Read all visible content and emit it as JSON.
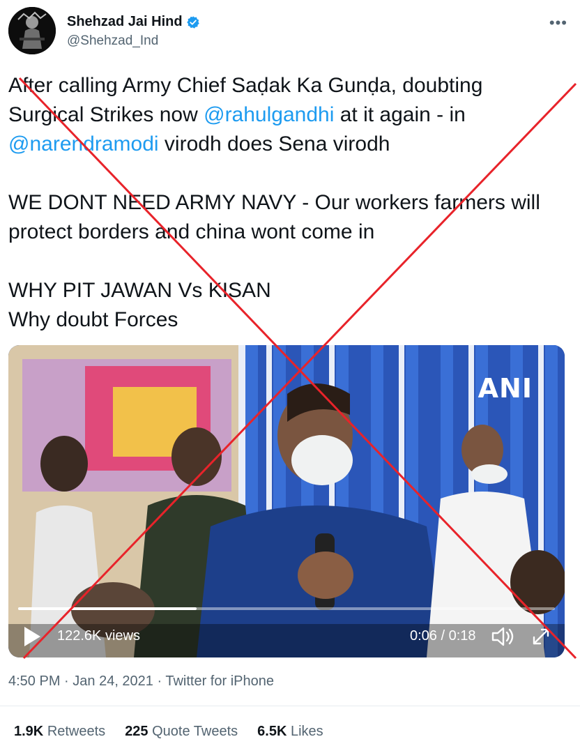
{
  "author": {
    "display_name": "Shehzad Jai Hind",
    "handle": "@Shehzad_Ind",
    "verified": true
  },
  "tweet": {
    "lines": [
      [
        {
          "t": "After calling Army Chief Saḍak Ka Gunḍa, doubting",
          "m": false
        }
      ],
      [
        {
          "t": "Surgical Strikes now ",
          "m": false
        },
        {
          "t": "@rahulgandhi",
          "m": true
        },
        {
          "t": " at it again - in",
          "m": false
        }
      ],
      [
        {
          "t": "@narendramodi",
          "m": true
        },
        {
          "t": " virodh does Sena virodh",
          "m": false
        }
      ],
      [],
      [
        {
          "t": "WE DONT NEED ARMY NAVY - Our workers farmers will",
          "m": false
        }
      ],
      [
        {
          "t": "protect borders and china wont come in",
          "m": false
        }
      ],
      [],
      [
        {
          "t": "WHY PIT JAWAN Vs KISAN",
          "m": false
        }
      ],
      [
        {
          "t": "Why doubt Forces",
          "m": false
        }
      ]
    ]
  },
  "video": {
    "watermark": "ANI",
    "views": "122.6K views",
    "time": "0:06 / 0:18",
    "progress": 0.333
  },
  "meta": {
    "time": "4:50 PM",
    "sep1": " · ",
    "date": "Jan 24, 2021",
    "sep2": " · ",
    "client": "Twitter for iPhone"
  },
  "stats": {
    "retweets_count": "1.9K",
    "retweets_label": "Retweets",
    "quotes_count": "225",
    "quotes_label": "Quote Tweets",
    "likes_count": "6.5K",
    "likes_label": "Likes"
  },
  "colors": {
    "link": "#1d9bf0",
    "secondary": "#536471",
    "cross": "#e8232a"
  },
  "icons": [
    "avatar",
    "verified-badge-icon",
    "more-icon",
    "play-icon",
    "volume-icon",
    "fullscreen-icon"
  ]
}
